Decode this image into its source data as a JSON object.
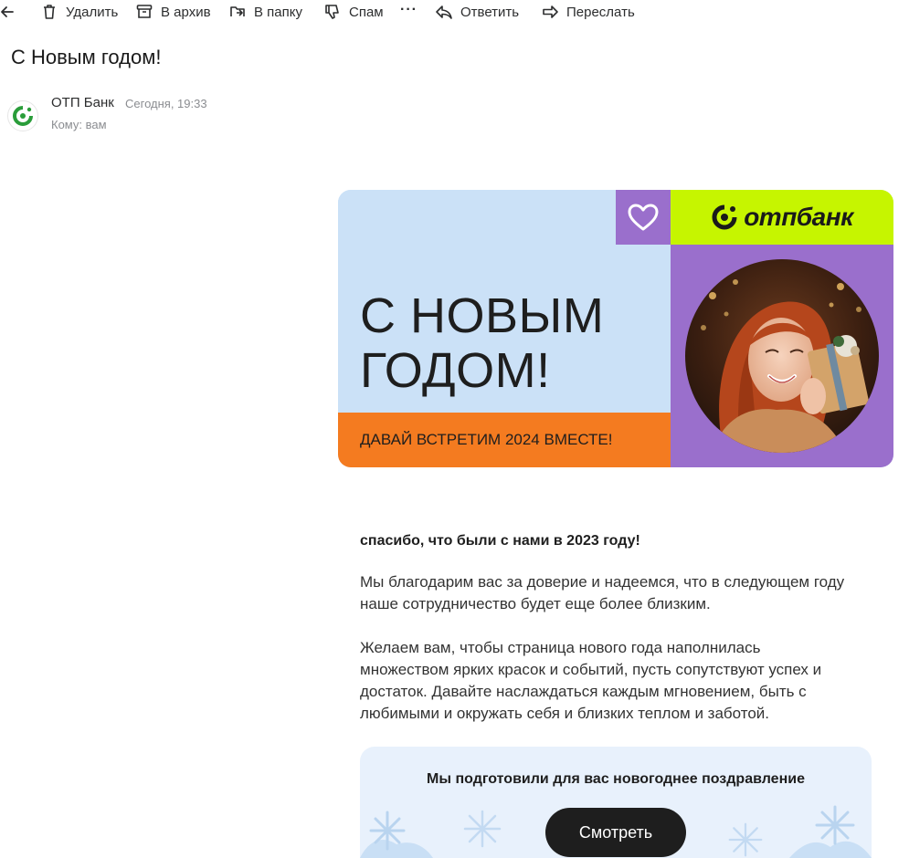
{
  "toolbar": {
    "delete_label": "Удалить",
    "archive_label": "В архив",
    "folder_label": "В папку",
    "spam_label": "Спам",
    "more_label": "···",
    "reply_label": "Ответить",
    "forward_label": "Переслать"
  },
  "message": {
    "subject": "С Новым годом!",
    "sender_name": "ОТП Банк",
    "sent_time": "Сегодня, 19:33",
    "to_line": "Кому: вам"
  },
  "banner": {
    "title_line1": "С НОВЫМ",
    "title_line2": "ГОДОМ!",
    "subtitle": "ДАВАЙ ВСТРЕТИМ 2024 ВМЕСТЕ!",
    "logo_text": "отпбанк"
  },
  "body": {
    "greeting": "спасибо, что были с нами в 2023 году!",
    "paragraph1": "Мы благодарим вас за доверие и надеемся, что в следующем году наше сотрудничество будет еще более близким.",
    "paragraph2": "Желаем вам, чтобы страница нового года наполнилась множеством ярких красок и событий, пусть сопутствуют успех и достаток. Давайте наслаждаться каждым мгновением, быть с любимыми и окружать себя и близких теплом и заботой."
  },
  "cta": {
    "title": "Мы подготовили для вас новогоднее поздравление",
    "button_label": "Смотреть"
  },
  "colors": {
    "banner_blue": "#cbe1f7",
    "banner_orange": "#f47b20",
    "banner_purple": "#9a6fcc",
    "logo_lime": "#c6f500",
    "otp_green": "#2a9d3a",
    "cta_background": "#e8f1fc",
    "cta_button": "#1e1e1e"
  },
  "icons": [
    "back-arrow-icon",
    "trash-icon",
    "archive-icon",
    "folder-move-icon",
    "thumbs-down-icon",
    "more-icon",
    "reply-icon",
    "forward-icon",
    "heart-icon",
    "otp-logo-icon",
    "snowflake-icon"
  ]
}
